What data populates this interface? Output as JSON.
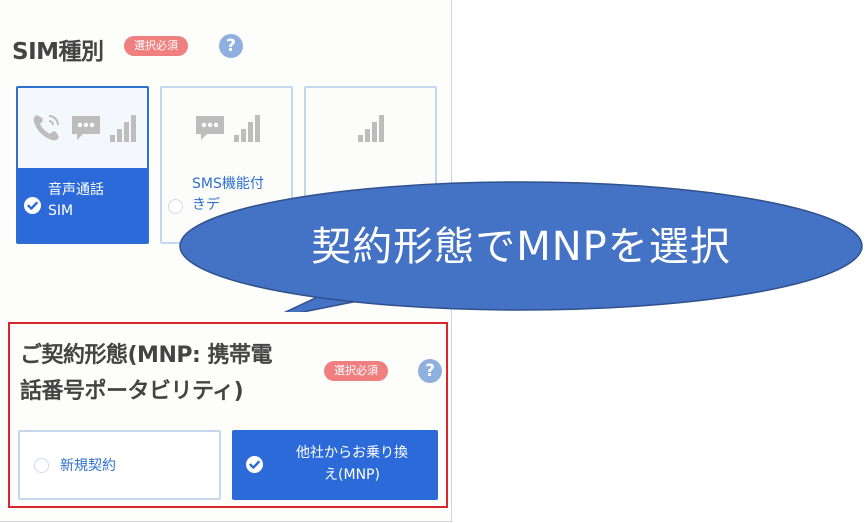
{
  "sim_section": {
    "title": "SIM種別",
    "required_badge": "選択必須",
    "help": "?",
    "cards": [
      {
        "label_line1": "音声通話",
        "label_line2": "SIM",
        "selected": true,
        "icons": [
          "phone-icon",
          "chat-icon",
          "signal-icon"
        ]
      },
      {
        "label_line1": "SMS機能付",
        "label_line2": "きデ",
        "selected": false,
        "icons": [
          "chat-icon",
          "signal-icon"
        ]
      },
      {
        "label_line1": "",
        "label_line2": "",
        "selected": false,
        "icons": [
          "signal-icon"
        ]
      }
    ]
  },
  "contract_section": {
    "title_line1": "ご契約形態(MNP: 携帯電",
    "title_line2": "話番号ポータビリティ)",
    "required_badge": "選択必須",
    "help": "?",
    "options": [
      {
        "label": "新規契約",
        "selected": false
      },
      {
        "label_line1": "他社からお乗り換",
        "label_line2": "え(MNP)",
        "selected": true
      }
    ]
  },
  "callout": {
    "text": "契約形態でMNPを選択"
  },
  "colors": {
    "accent_blue": "#2b6ad8",
    "callout_fill": "#4472c4",
    "badge_red": "#f08080",
    "highlight_border": "#d9262b"
  }
}
